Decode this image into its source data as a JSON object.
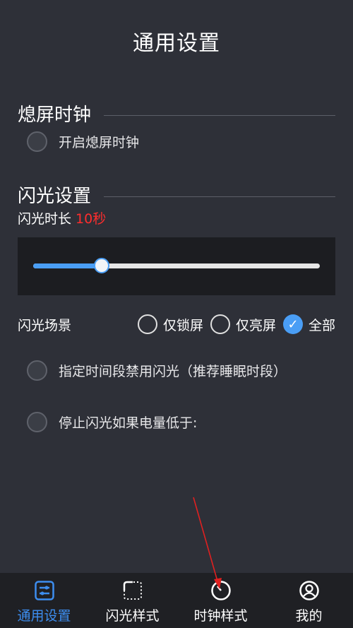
{
  "header": {
    "title": "通用设置"
  },
  "sections": {
    "screen_off_clock": {
      "title": "熄屏时钟",
      "toggle_label": "开启熄屏时钟"
    },
    "flash": {
      "title": "闪光设置",
      "duration_label": "闪光时长",
      "duration_value": "10秒",
      "slider_level": 0.24,
      "scene_label": "闪光场景",
      "scene_options": [
        "仅锁屏",
        "仅亮屏",
        "全部"
      ],
      "scene_selected": "全部",
      "disable_period_label": "指定时间段禁用闪光（推荐睡眠时段）",
      "battery_stop_label": "停止闪光如果电量低于:"
    }
  },
  "tabs": [
    {
      "label": "通用设置",
      "icon": "settings-sliders-icon",
      "active": true
    },
    {
      "label": "闪光样式",
      "icon": "dashed-frame-icon",
      "active": false
    },
    {
      "label": "时钟样式",
      "icon": "clock-icon",
      "active": false
    },
    {
      "label": "我的",
      "icon": "user-icon",
      "active": false
    }
  ],
  "colors": {
    "background": "#2e3038",
    "accent": "#4a9ef5",
    "active_tab": "#3d8ef0",
    "highlight_value": "#ff2d2d",
    "annotation_arrow": "#e02020"
  }
}
